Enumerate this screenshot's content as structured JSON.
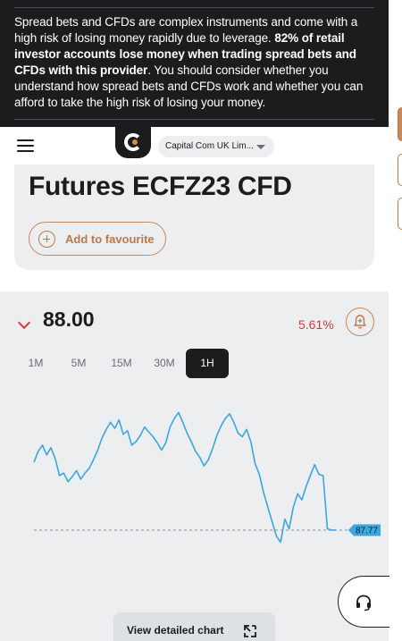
{
  "risk_banner": {
    "text_part1": "Spread bets and CFDs are complex instruments and come with a high risk of losing money rapidly due to leverage. ",
    "text_bold": "82% of retail investor accounts lose money when trading spread bets and CFDs with this provider",
    "text_part2": ". You should consider whether you understand how spread bets and CFDs work and whether you can afford to take the high risk of losing your money."
  },
  "header": {
    "menu_icon": "hamburger-menu-icon",
    "logo_icon": "capital-com-logo",
    "entity_label": "Capital Com UK Lim..."
  },
  "instrument": {
    "title": "Futures ECFZ23 CFD",
    "favourite_label": "Add to favourite"
  },
  "quote": {
    "direction_icon": "chevron-down-icon",
    "price": "88.00",
    "change": "5.61%",
    "alert_icon": "bell-plus-icon",
    "change_color": "#d63b3b"
  },
  "timeframes": {
    "items": [
      "1M",
      "5M",
      "15M",
      "30M",
      "1H"
    ],
    "selected": "1H"
  },
  "chart_data": {
    "type": "line",
    "series": [
      {
        "values": [
          88.33,
          88.42,
          88.47,
          88.39,
          88.45,
          88.36,
          88.22,
          88.24,
          88.17,
          88.21,
          88.26,
          88.19,
          88.24,
          88.28,
          88.35,
          88.43,
          88.53,
          88.6,
          88.66,
          88.61,
          88.68,
          88.56,
          88.59,
          88.47,
          88.5,
          88.55,
          88.62,
          88.58,
          88.54,
          88.49,
          88.43,
          88.49,
          88.62,
          88.69,
          88.74,
          88.66,
          88.57,
          88.5,
          88.42,
          88.37,
          88.3,
          88.35,
          88.44,
          88.55,
          88.63,
          88.69,
          88.73,
          88.66,
          88.57,
          88.54,
          88.6,
          88.5,
          88.32,
          88.23,
          88.08,
          87.96,
          87.84,
          87.72,
          87.67,
          87.86,
          87.78,
          87.96,
          88.07,
          88.02,
          88.13,
          88.22,
          88.31,
          88.23,
          88.22,
          87.78,
          87.77,
          87.77
        ]
      }
    ],
    "last_value": "87.77",
    "line_color": "#3aa7e0",
    "reference_line": "dashed",
    "grid": false
  },
  "detail_button": {
    "label": "View detailed chart",
    "icon": "expand-icon"
  },
  "support": {
    "icon": "headset-icon"
  },
  "colors": {
    "accent": "#c7895a",
    "dark": "#1b1c1e",
    "panel": "#eceef0",
    "negative": "#d63b3b",
    "chart": "#3aa7e0"
  }
}
